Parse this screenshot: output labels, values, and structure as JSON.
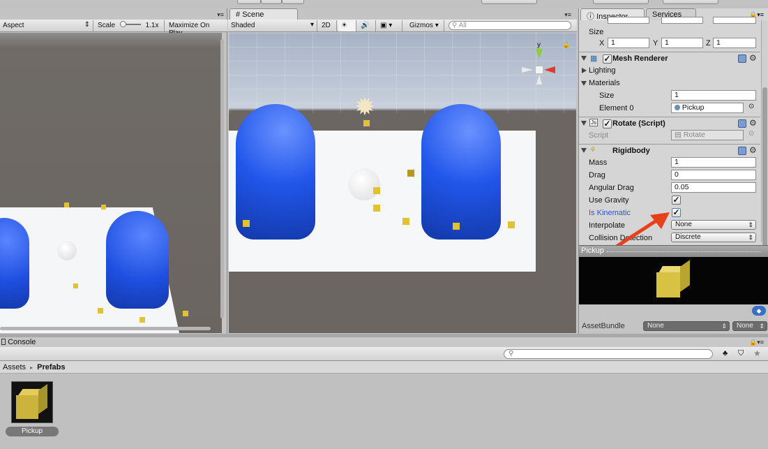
{
  "game_panel": {
    "aspect_label": "Aspect",
    "scale_label": "Scale",
    "scale_value": "1.1x",
    "maximize_label": "Maximize On Play"
  },
  "scene_panel": {
    "tab_label": "Scene",
    "shading_mode": "Shaded",
    "mode_2d": "2D",
    "gizmos_label": "Gizmos",
    "search_placeholder": "All",
    "gizmo_axis_y": "y"
  },
  "inspector": {
    "tabs": [
      {
        "label": "Inspector"
      },
      {
        "label": "Services"
      }
    ],
    "transform": {
      "size_label": "Size",
      "x_label": "X",
      "x_value": "1",
      "y_label": "Y",
      "y_value": "1",
      "z_label": "Z",
      "z_value": "1"
    },
    "mesh_renderer": {
      "title": "Mesh Renderer",
      "lighting_label": "Lighting",
      "materials_label": "Materials",
      "size_label": "Size",
      "size_value": "1",
      "element0_label": "Element 0",
      "element0_value": "Pickup"
    },
    "rotate_script": {
      "title": "Rotate (Script)",
      "script_label": "Script",
      "script_value": "Rotate"
    },
    "rigidbody": {
      "title": "Rigidbody",
      "mass_label": "Mass",
      "mass_value": "1",
      "drag_label": "Drag",
      "drag_value": "0",
      "angular_drag_label": "Angular Drag",
      "angular_drag_value": "0.05",
      "use_gravity_label": "Use Gravity",
      "use_gravity": true,
      "is_kinematic_label": "Is Kinematic",
      "is_kinematic": true,
      "interpolate_label": "Interpolate",
      "interpolate_value": "None",
      "collision_label": "Collision Detection",
      "collision_value": "Discrete"
    },
    "preview": {
      "title": "Pickup",
      "assetbundle_label": "AssetBundle",
      "assetbundle_value": "None",
      "variant_value": "None"
    }
  },
  "console": {
    "tab_label": "Console"
  },
  "project": {
    "breadcrumb_root": "Assets",
    "breadcrumb_sep": "▸",
    "breadcrumb_current": "Prefabs",
    "assets": [
      {
        "name": "Pickup"
      }
    ]
  },
  "colors": {
    "capsule_blue": "#1e4fe0",
    "pickup_yellow": "#d9c24a",
    "arrow_red": "#e8401c",
    "kinematic_label": "#2f55c9"
  }
}
